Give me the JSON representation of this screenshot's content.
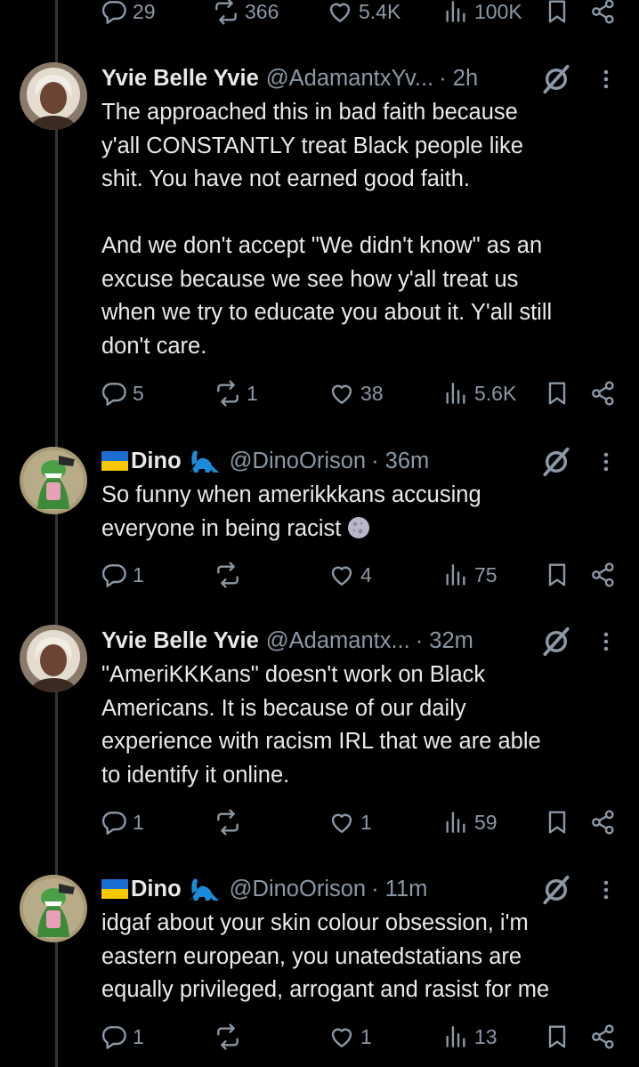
{
  "colors": {
    "background": "#000000",
    "text": "#e7e9ea",
    "muted": "#8b98a5",
    "thread_line": "#333639"
  },
  "top_actions": {
    "replies": "29",
    "reposts": "366",
    "likes": "5.4K",
    "views": "100K"
  },
  "tweets": [
    {
      "name": "Yvie Belle Yvie",
      "handle": "@AdamantxYv...",
      "time": "· 2h",
      "text": "The approached this in bad faith because\ny'all CONSTANTLY treat Black people like\nshit. You have not earned good faith.\n\nAnd we don't accept \"We didn't know\" as an\nexcuse because we see how y'all treat us\nwhen we try to educate you about it. Y'all still\ndon't care.",
      "replies": "5",
      "reposts": "1",
      "likes": "38",
      "views": "5.6K"
    },
    {
      "name": "Dino",
      "handle": "@DinoOrison",
      "time": "· 36m",
      "text": "So funny when amerikkkans accusing\neveryone in being racist",
      "replies": "1",
      "reposts": "",
      "likes": "4",
      "views": "75"
    },
    {
      "name": "Yvie Belle Yvie",
      "handle": "@Adamantx...",
      "time": "· 32m",
      "text": "\"AmeriKKKans\" doesn't work on Black\nAmericans. It is because of our daily\nexperience with racism IRL that we are able\nto identify it online.",
      "replies": "1",
      "reposts": "",
      "likes": "1",
      "views": "59"
    },
    {
      "name": "Dino",
      "handle": "@DinoOrison",
      "time": "· 11m",
      "text": "idgaf about your skin colour obsession, i'm\neastern european, you unatedstatians are\nequally privileged, arrogant and rasist for me",
      "replies": "1",
      "reposts": "",
      "likes": "1",
      "views": "13"
    }
  ],
  "icons": [
    "reply-icon",
    "repost-icon",
    "like-icon",
    "views-icon",
    "bookmark-icon",
    "share-icon",
    "grok-icon",
    "more-icon",
    "ukraine-flag-icon",
    "dinosaur-emoji",
    "moon-emoji"
  ]
}
